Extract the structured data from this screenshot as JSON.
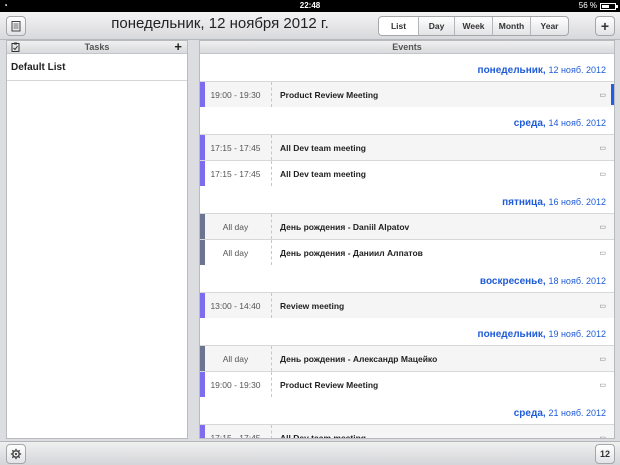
{
  "status": {
    "time": "22:48",
    "battery": "56 %"
  },
  "header": {
    "title": "понедельник, 12 ноября 2012 г.",
    "views": [
      "List",
      "Day",
      "Week",
      "Month",
      "Year"
    ],
    "active_view": "List",
    "add_label": "+"
  },
  "tasks": {
    "title": "Tasks",
    "add_label": "+",
    "lists": [
      "Default List"
    ]
  },
  "events": {
    "title": "Events",
    "days": [
      {
        "name": "понедельник,",
        "date": "12 нояб. 2012",
        "items": [
          {
            "time": "19:00 - 19:30",
            "name": "Product Review Meeting",
            "color": "#7b6cf0"
          }
        ]
      },
      {
        "name": "среда,",
        "date": "14 нояб. 2012",
        "items": [
          {
            "time": "17:15 - 17:45",
            "name": "All Dev team meeting",
            "color": "#7b6cf0"
          },
          {
            "time": "17:15 - 17:45",
            "name": "All Dev team meeting",
            "color": "#7b6cf0"
          }
        ]
      },
      {
        "name": "пятница,",
        "date": "16 нояб. 2012",
        "items": [
          {
            "time": "All day",
            "name": "День рождения - Daniil Alpatov",
            "color": "#6b7591"
          },
          {
            "time": "All day",
            "name": "День рождения - Даниил Алпатов",
            "color": "#6b7591"
          }
        ]
      },
      {
        "name": "воскресенье,",
        "date": "18 нояб. 2012",
        "items": [
          {
            "time": "13:00 - 14:40",
            "name": "Review meeting",
            "color": "#7b6cf0"
          }
        ]
      },
      {
        "name": "понедельник,",
        "date": "19 нояб. 2012",
        "items": [
          {
            "time": "All day",
            "name": "День рождения - Александр Мацейко",
            "color": "#6b7591"
          },
          {
            "time": "19:00 - 19:30",
            "name": "Product Review Meeting",
            "color": "#7b6cf0"
          }
        ]
      },
      {
        "name": "среда,",
        "date": "21 нояб. 2012",
        "items": [
          {
            "time": "17:15 - 17:45",
            "name": "All Dev team meeting",
            "color": "#7b6cf0"
          }
        ]
      }
    ]
  },
  "footer": {
    "today_number": "12"
  }
}
